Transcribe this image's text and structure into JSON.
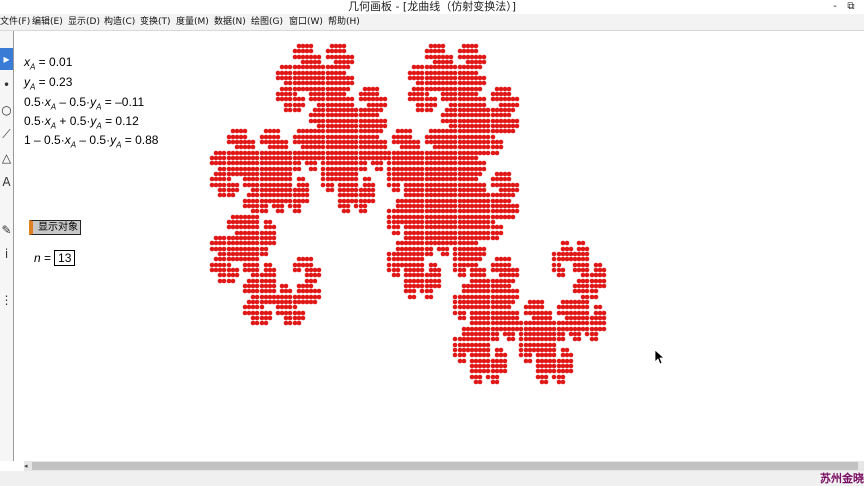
{
  "window": {
    "title": "几何画板 - [龙曲线（仿射变换法）]",
    "minimize": "-",
    "restore": "⧉"
  },
  "menu": [
    "文件(F)",
    "编辑(E)",
    "显示(D)",
    "构造(C)",
    "变换(T)",
    "度量(M)",
    "数据(N)",
    "绘图(G)",
    "窗口(W)",
    "帮助(H)"
  ],
  "toolbar": {
    "tools": [
      {
        "icon": "selection-arrow-icon",
        "glyph": "▸"
      },
      {
        "icon": "point-tool-icon",
        "glyph": "•"
      },
      {
        "icon": "compass-circle-icon",
        "glyph": "○"
      },
      {
        "icon": "straightedge-icon",
        "glyph": "⟋"
      },
      {
        "icon": "polygon-icon",
        "glyph": "△"
      },
      {
        "icon": "text-tool-icon",
        "glyph": "A"
      },
      {
        "icon": "marker-pen-icon",
        "glyph": "✎"
      },
      {
        "icon": "info-icon",
        "glyph": "i"
      },
      {
        "icon": "custom-tool-icon",
        "glyph": "⋮"
      }
    ]
  },
  "measurements": {
    "xA": "0.01",
    "yA": "0.23",
    "expr1": "–0.11",
    "expr2": "0.12",
    "expr3": "0.88"
  },
  "show_objects_button": "显示对象",
  "parameter": {
    "name": "n",
    "value": "13"
  },
  "fractal": {
    "name": "dragon-curve",
    "iterations": 13,
    "color": "#e01818"
  },
  "scrollbar": {
    "left_arrow": "◂"
  },
  "watermark": "苏州金晓"
}
